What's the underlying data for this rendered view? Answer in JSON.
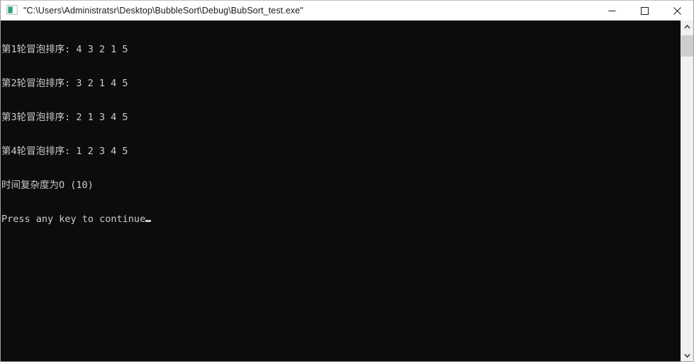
{
  "window": {
    "title": "\"C:\\Users\\Administratsr\\Desktop\\BubbleSort\\Debug\\BubSort_test.exe\"",
    "icon": "console-window-icon",
    "background_color": "#ffffff",
    "border_color": "#a0a0a0"
  },
  "titlebar": {
    "minimize_label": "minimize-icon",
    "maximize_label": "maximize-icon",
    "close_label": "close-icon"
  },
  "console": {
    "background_color": "#0c0c0c",
    "foreground_color": "#cccccc",
    "lines": [
      "第1轮冒泡排序: 4 3 2 1 5",
      "第2轮冒泡排序: 3 2 1 4 5",
      "第3轮冒泡排序: 2 1 3 4 5",
      "第4轮冒泡排序: 1 2 3 4 5",
      "时间复杂度为O (10)",
      "Press any key to continue"
    ]
  },
  "scrollbar": {
    "up_arrow": "chevron-up-icon",
    "down_arrow": "chevron-down-icon",
    "thumb_color": "#cdcdcd",
    "track_color": "#f0f0f0"
  }
}
